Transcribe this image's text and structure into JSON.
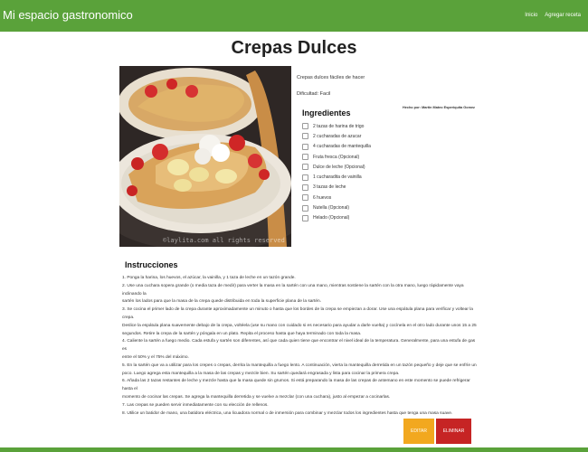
{
  "header": {
    "brand": "Mi espacio gastronomico",
    "nav": [
      "Inicio",
      "Agregar receta"
    ]
  },
  "recipe": {
    "title": "Crepas Dulces",
    "description": "Crepas dulces fáciles de hacer",
    "difficulty": "Dificultad: Facil",
    "author": "Hecho por: Martin Mateo Esperiquita Gomez",
    "image_watermark": "©laylita.com all rights reserved"
  },
  "ingredients": {
    "title": "Ingredientes",
    "items": [
      "2 tazas de harina de trigo",
      "2 cucharadas de azucar",
      "4 cucharadas de mantequilla",
      "Fruta fresca (Opcional)",
      "Dulce de leche (Opcional)",
      "1 cucharadita de vainilla",
      "3 tazas de leche",
      "6 huevos",
      "Nutella (Opcional)",
      "Helado (Opcional)"
    ]
  },
  "instructions": {
    "title": "Instrucciones",
    "steps": [
      "1. Ponga la harina, los huevos, el azúcar, la vainilla, y 1 taza de leche en un tazón grande.",
      "2. Use una cuchara sopera grande (o media taza de medir) para verter la masa en la sartén con una mano, mientras sostiene la sartén con la otra mano, luego rápidamente vaya inclinando la",
      "   sartén los lados para que la masa de la crepa quede distribuida en toda la superficie plana de la sartén.",
      "3. Se cocina el primer lado de la crepa durante aproximadamente un minuto o hasta que los bordes de la crepa se empiezan a dorar. Use una espátula plana para verificar y voltear la crepa.",
      "   Deslice la espátula plana suavemente debajo de la crepa, voltéela (use su mano con cuidado si es necesario para ayudar a darle vuelta) y cocínela en el otro lado durante unos 15 a 25",
      "   segundos. Retire la crepa de la sartén y póngala en un plato. Repita el proceso hasta que haya terminado con toda la masa.",
      "4. Caliente la sartén a fuego medio. Cada estufa y sartén son diferentes, así que cada quien tiene que encontrar el nivel ideal de la temperatura. Generalmente, para una estufa de gas es",
      "   entre el 50% y el 75% del máximo.",
      "5. En la sartén que va a utilizar para los crepes o crepas, derrita la mantequilla a fuego lento. A continuación, vierta la mantequilla derretida en un tazón pequeño y deje que se enfríe un",
      "   poco. Luego agrega esta mantequilla a la masa de las crepas y mezcle bien. Su sartén quedará engrasada y lista para cocinar la primera crepa.",
      "6. Añada las 2 tazas restantes de leche y mezcle hasta que la masa quede sin grumos. Si está preparando la masa de las crepas de antemano en este momento se puede refrigerar hasta el",
      "   momento de cocinar las crepas. Se agrega la mantequilla derretida y se vuelve a mezclar (con una cuchara), justo al empezar a cocinarlas.",
      "7. Las crepas se pueden servir inmediatamente con su elección de rellenos.",
      "8. Utilice un batidor de mano, una batidora eléctrica, una licuadora normal o de inmersión para combinar y mezclar todos los ingredientes hasta que tenga una masa suave."
    ]
  },
  "actions": {
    "edit_label": "EDITAR",
    "delete_label": "ELIMINAR"
  },
  "colors": {
    "brand_green": "#5aa23a",
    "edit_orange": "#f2a81f",
    "delete_red": "#c62424"
  }
}
